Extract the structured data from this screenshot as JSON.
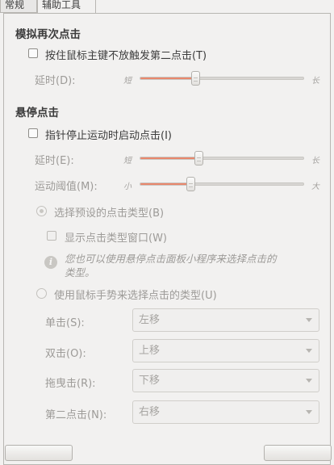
{
  "tabs": [
    {
      "label": "常规",
      "active": false
    },
    {
      "label": "辅助工具",
      "active": true
    }
  ],
  "simulated_secondary_click": {
    "heading": "模拟再次点击",
    "checkbox_label": "按住鼠标主键不放触发第二点击(T)",
    "checked": false,
    "delay": {
      "label": "延时(D):",
      "min_label": "短",
      "max_label": "长",
      "level": 0.34
    }
  },
  "hover_click": {
    "heading": "悬停点击",
    "checkbox_label": "指针停止运动时启动点击(I)",
    "checked": false,
    "delay": {
      "label": "延时(E):",
      "min_label": "短",
      "max_label": "长",
      "level": 0.36
    },
    "motion_threshold": {
      "label": "运动阈值(M):",
      "min_label": "小",
      "max_label": "大",
      "level": 0.31
    },
    "radio_predefined": {
      "label": "选择预设的点击类型(B)",
      "selected": true
    },
    "show_click_type_window": {
      "label": "显示点击类型窗口(W)",
      "checked": false
    },
    "info_text_line1": "您也可以使用悬停点击面板小程序来选择点击的",
    "info_text_line2": "类型。",
    "radio_gestures": {
      "label": "使用鼠标手势来选择点击的类型(U)",
      "selected": false
    },
    "gesture_rows": [
      {
        "label": "单击(S):",
        "value": "左移"
      },
      {
        "label": "双击(O):",
        "value": "上移"
      },
      {
        "label": "拖曳击(R):",
        "value": "下移"
      },
      {
        "label": "第二点击(N):",
        "value": "右移"
      }
    ]
  },
  "colors": {
    "slider_fill": "#e9876c",
    "disabled_text": "#9d9b98"
  }
}
